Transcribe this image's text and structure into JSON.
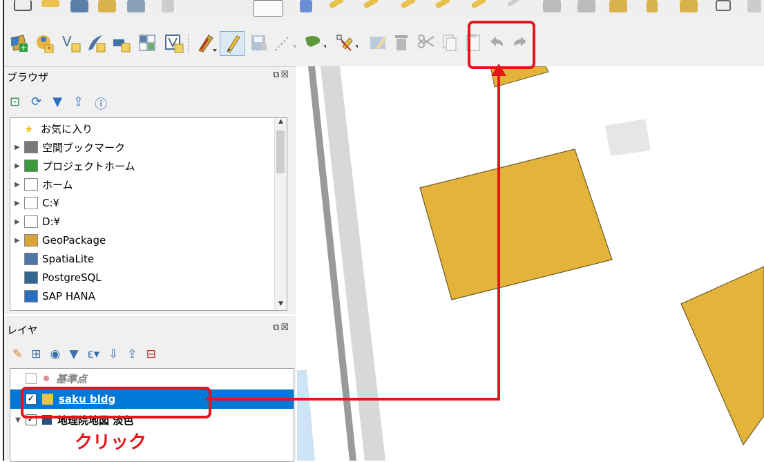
{
  "browser_panel": {
    "title": "ブラウザ",
    "items": [
      {
        "label": "お気に入り",
        "icon": "star-icon",
        "expandable": false
      },
      {
        "label": "空間ブックマーク",
        "icon": "bookmark-icon",
        "expandable": true
      },
      {
        "label": "プロジェクトホーム",
        "icon": "project-home-icon",
        "expandable": true
      },
      {
        "label": "ホーム",
        "icon": "home-folder-icon",
        "expandable": true
      },
      {
        "label": "C:¥",
        "icon": "folder-icon",
        "expandable": true
      },
      {
        "label": "D:¥",
        "icon": "folder-icon",
        "expandable": true
      },
      {
        "label": "GeoPackage",
        "icon": "geopackage-icon",
        "expandable": true
      },
      {
        "label": "SpatiaLite",
        "icon": "spatialite-icon",
        "expandable": false
      },
      {
        "label": "PostgreSQL",
        "icon": "postgresql-icon",
        "expandable": false
      },
      {
        "label": "SAP HANA",
        "icon": "sap-hana-icon",
        "expandable": false
      }
    ]
  },
  "layers_panel": {
    "title": "レイヤ",
    "layers": [
      {
        "label": "基準点",
        "checked": false
      },
      {
        "label": "saku bldg",
        "checked": true,
        "selected": true
      },
      {
        "label": "地理院地図 淡色",
        "checked": true
      }
    ]
  },
  "annotation": {
    "click_label": "クリック",
    "color": "#e5141b"
  },
  "colors": {
    "building_fill": "#e3b33a",
    "selection": "#0078d7"
  }
}
